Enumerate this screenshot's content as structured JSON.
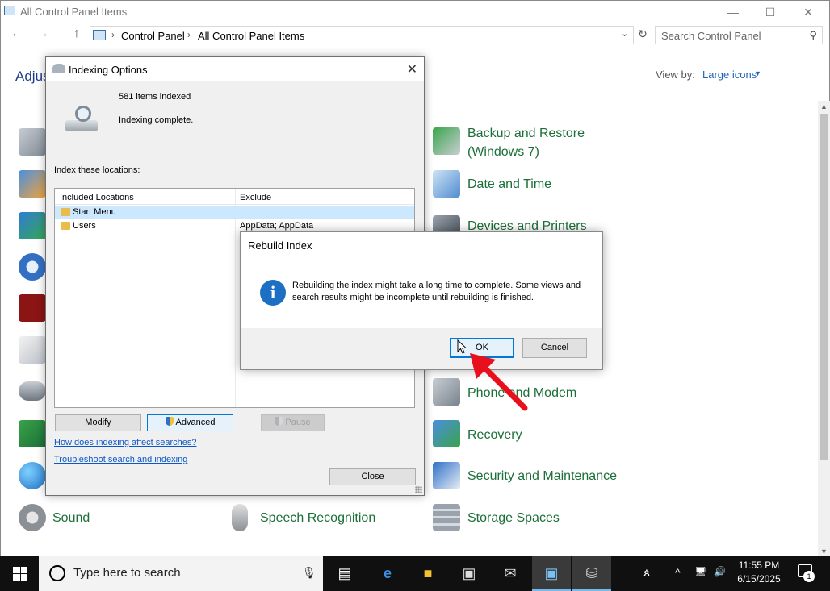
{
  "window": {
    "title": "All Control Panel Items",
    "controls": {
      "minimize": "—",
      "maximize": "☐",
      "close": "✕"
    }
  },
  "address": {
    "crumbs": [
      "Control Panel",
      "All Control Panel Items"
    ],
    "separator": "›",
    "dropdown": "⌄",
    "refresh": "↻",
    "search_placeholder": "Search Control Panel"
  },
  "nav": {
    "back": "←",
    "forward": "→",
    "up": "↑"
  },
  "content": {
    "heading": "Adjus",
    "view_by_label": "View by:",
    "view_by_value": "Large icons",
    "caret": "▼"
  },
  "cp_items": {
    "backup": "Backup and Restore\n(Windows 7)",
    "datetime": "Date and Time",
    "devices": "Devices and Printers",
    "phone": "Phone and Modem",
    "recovery": "Recovery",
    "security": "Security and Maintenance",
    "sound": "Sound",
    "speech": "Speech Recognition",
    "storage": "Storage Spaces"
  },
  "indexing_dialog": {
    "title": "Indexing Options",
    "close": "✕",
    "items_indexed": "581 items indexed",
    "status": "Indexing complete.",
    "locations_label": "Index these locations:",
    "columns": {
      "included": "Included Locations",
      "exclude": "Exclude"
    },
    "rows": [
      {
        "name": "Start Menu",
        "exclude": ""
      },
      {
        "name": "Users",
        "exclude": "AppData; AppData"
      }
    ],
    "buttons": {
      "modify": "Modify",
      "advanced": "Advanced",
      "pause": "Pause",
      "close": "Close"
    },
    "links": {
      "how": "How does indexing affect searches?",
      "troubleshoot": "Troubleshoot search and indexing"
    }
  },
  "rebuild_dialog": {
    "title": "Rebuild Index",
    "icon_glyph": "i",
    "message": "Rebuilding the index might take a long time to complete. Some views and search results might be incomplete until rebuilding is finished.",
    "ok": "OK",
    "cancel": "Cancel"
  },
  "taskbar": {
    "search_placeholder": "Type here to search",
    "time": "11:55 PM",
    "date": "6/15/2025",
    "notification_count": "1",
    "tray": {
      "people": "ጰ",
      "chevron": "^",
      "volume": "🔊"
    }
  },
  "colors": {
    "link_green": "#1b6f38",
    "accent_blue": "#0078d7",
    "arrow_red": "#e8101c",
    "taskbar": "#101010"
  }
}
